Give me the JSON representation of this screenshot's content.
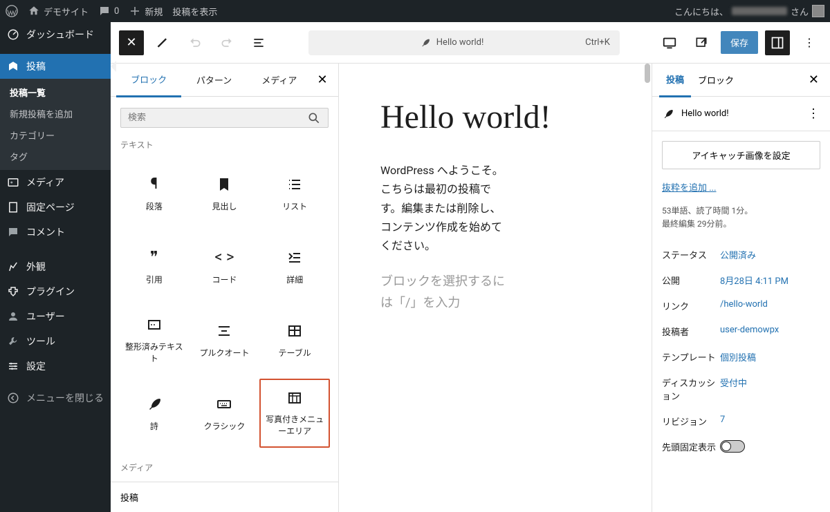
{
  "adminbar": {
    "site_name": "デモサイト",
    "comments_count": "0",
    "new_label": "新規",
    "view_post_label": "投稿を表示",
    "greeting_prefix": "こんにちは、",
    "greeting_suffix": " さん"
  },
  "adminmenu": {
    "dashboard": "ダッシュボード",
    "posts": "投稿",
    "posts_sub": {
      "all": "投稿一覧",
      "new": "新規投稿を追加",
      "categories": "カテゴリー",
      "tags": "タグ"
    },
    "media": "メディア",
    "pages": "固定ページ",
    "comments": "コメント",
    "appearance": "外観",
    "plugins": "プラグイン",
    "users": "ユーザー",
    "tools": "ツール",
    "settings": "設定",
    "collapse": "メニューを閉じる"
  },
  "editor_header": {
    "doc_title": "Hello world!",
    "shortcut": "Ctrl+K",
    "save_label": "保存"
  },
  "inserter": {
    "tabs": {
      "blocks": "ブロック",
      "patterns": "パターン",
      "media": "メディア"
    },
    "search_placeholder": "検索",
    "section_text": "テキスト",
    "section_media": "メディア",
    "blocks": {
      "paragraph": "段落",
      "heading": "見出し",
      "list": "リスト",
      "quote": "引用",
      "code": "コード",
      "details": "詳細",
      "preformatted": "整形済みテキスト",
      "pullquote": "プルクオート",
      "table": "テーブル",
      "verse": "詩",
      "classic": "クラシック",
      "photo_menu": "写真付きメニューエリア"
    },
    "footer": "投稿"
  },
  "canvas": {
    "title": "Hello world!",
    "body": "WordPress へようこそ。こちらは最初の投稿です。編集または削除し、コンテンツ作成を始めてください。",
    "placeholder": "ブロックを選択するには「/」を入力"
  },
  "settings": {
    "tabs": {
      "post": "投稿",
      "block": "ブロック"
    },
    "doc_title": "Hello world!",
    "featured_image_btn": "アイキャッチ画像を設定",
    "excerpt_link": "抜粋を追加 ...",
    "word_stats": "53単語、読了時間 1分。",
    "last_edit": "最終編集 29分前。",
    "rows": {
      "status_label": "ステータス",
      "status_value": "公開済み",
      "publish_label": "公開",
      "publish_value": "8月28日 4:11 PM",
      "link_label": "リンク",
      "link_value": "/hello-world",
      "author_label": "投稿者",
      "author_value": "user-demowpx",
      "template_label": "テンプレート",
      "template_value": "個別投稿",
      "discussion_label": "ディスカッション",
      "discussion_value": "受付中",
      "revisions_label": "リビジョン",
      "revisions_value": "7",
      "sticky_label": "先頭固定表示"
    }
  }
}
